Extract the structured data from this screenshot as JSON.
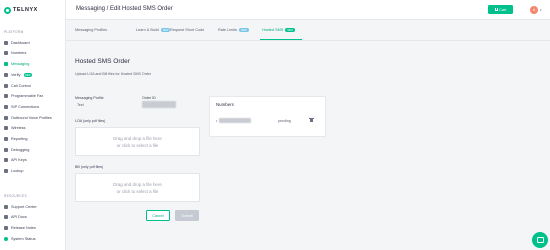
{
  "brand": {
    "logo_text": "TELNYX"
  },
  "sidebar": {
    "platform_title": "PLATFORM",
    "resources_title": "RESOURCES",
    "items": [
      {
        "label": "Dashboard",
        "icon": "home-icon"
      },
      {
        "label": "Numbers",
        "icon": "hash-icon"
      },
      {
        "label": "Messaging",
        "icon": "message-icon"
      },
      {
        "label": "Verify",
        "icon": "check-shield-icon",
        "badge": "NEW"
      },
      {
        "label": "Call Control",
        "icon": "phone-icon"
      },
      {
        "label": "Programmable Fax",
        "icon": "fax-icon"
      },
      {
        "label": "SIP Connections",
        "icon": "sip-icon"
      },
      {
        "label": "Outbound Voice Profiles",
        "icon": "outbound-icon"
      },
      {
        "label": "Wireless",
        "icon": "wifi-icon"
      },
      {
        "label": "Reporting",
        "icon": "chart-icon"
      },
      {
        "label": "Debugging",
        "icon": "bug-icon"
      },
      {
        "label": "API Keys",
        "icon": "key-icon"
      },
      {
        "label": "Lookup",
        "icon": "search-icon"
      }
    ],
    "resources": [
      {
        "label": "Support Center",
        "icon": "help-icon"
      },
      {
        "label": "API Docs",
        "icon": "code-icon"
      },
      {
        "label": "Release Notes",
        "icon": "notes-icon"
      },
      {
        "label": "System Status",
        "icon": "status-icon"
      }
    ]
  },
  "topbar": {
    "title": "Messaging / Edit Hosted SMS Order",
    "cart_label": "Cart",
    "avatar_initial": "A"
  },
  "tabs": [
    {
      "label": "Messaging Profiles"
    },
    {
      "label": "Learn & Build",
      "pill": "NEW"
    },
    {
      "label": "Request Short Code"
    },
    {
      "label": "Rate Limits",
      "pill": "NEW"
    },
    {
      "label": "Hosted SMS",
      "pill": "NEW",
      "active": true
    }
  ],
  "main": {
    "title": "Hosted SMS Order",
    "subtitle": "Upload LOA and Bill files for Hosted SMS Order",
    "profile_label": "Messaging Profile",
    "profile_value": "Test",
    "order_label": "Order ID",
    "loa_label": "LOA (only pdf files)",
    "bill_label": "Bill (only pdf files)",
    "dropzone_line1": "Drag and drop a file here",
    "dropzone_line2": "or click to select a file",
    "cancel_label": "Cancel",
    "submit_label": "Submit"
  },
  "numbers": {
    "title": "Numbers",
    "rows": [
      {
        "status": "pending"
      }
    ]
  },
  "colors": {
    "accent": "#00c08b",
    "avatar": "#f4866e"
  }
}
